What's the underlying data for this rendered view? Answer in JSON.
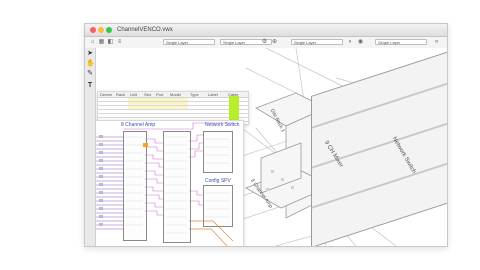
{
  "window": {
    "file_title": "ChannelVENCO.vwx"
  },
  "toolbar": {
    "selects": [
      "Single Layer",
      "Single Layer",
      "Single Layer",
      "Single Layer"
    ]
  },
  "tools": [
    "pointer-icon",
    "hand-icon",
    "pencil-icon",
    "text-icon"
  ],
  "diagram": {
    "amp_title": "8 Channel Amp",
    "switch_title": "Network Switch",
    "config_title": "Config SPV",
    "dist_rack": "Dist Rack 1",
    "mixer": "9 CH Mixer",
    "network_switch_iso": "Network Switch",
    "amp_iso": "8 Channel Amp",
    "table_headers": [
      "Device",
      "Rack",
      "Unit",
      "Slot",
      "Port",
      "Model",
      "Type",
      "Label",
      "Cable"
    ]
  },
  "colors": {
    "accent_green": "#b8ef2a",
    "wire_pink": "#d36fce",
    "wire_purple": "#8b5cc7",
    "wire_orange": "#e08a3a"
  }
}
